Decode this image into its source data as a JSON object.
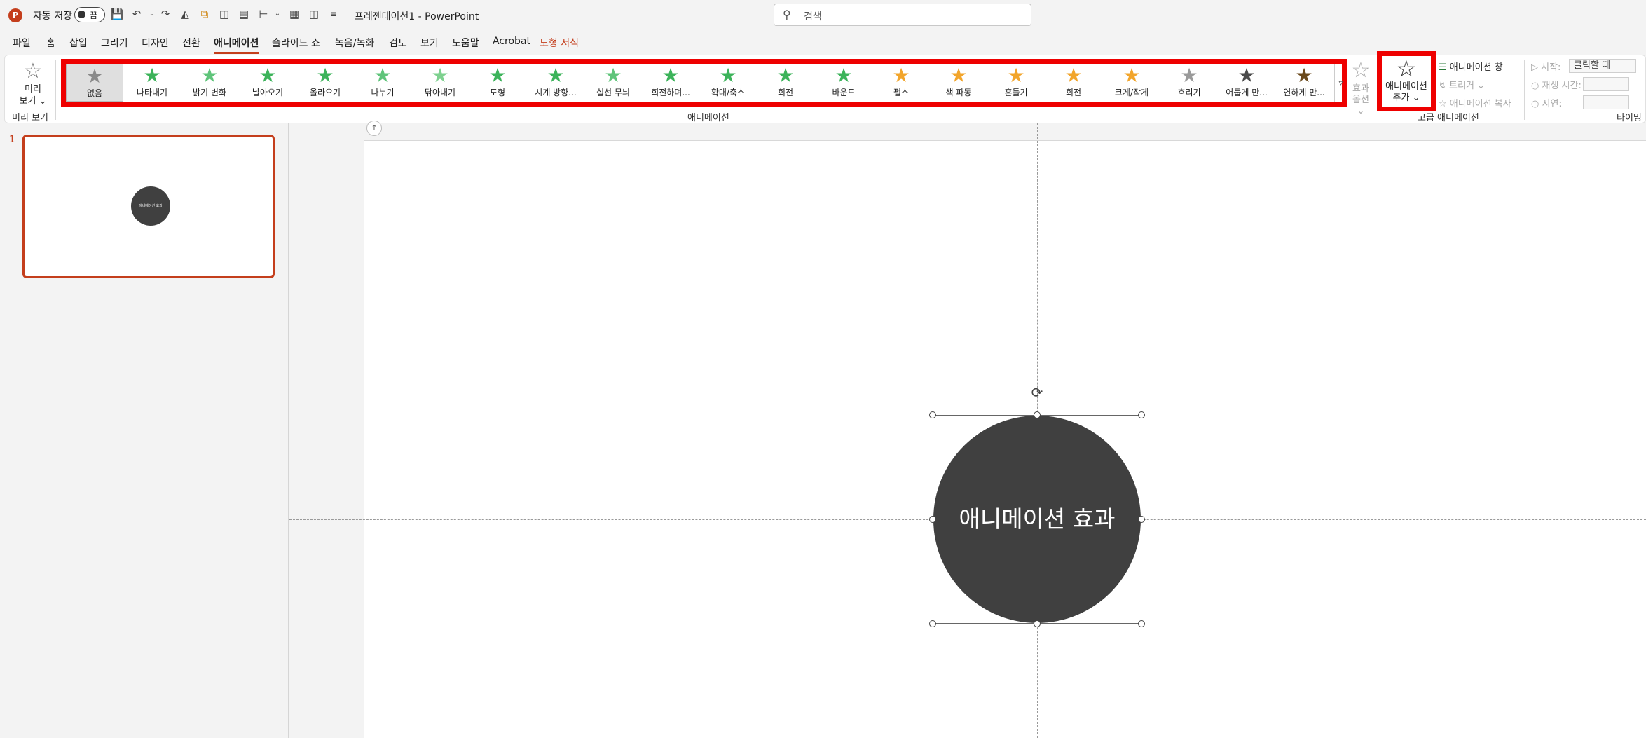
{
  "titlebar": {
    "app_logo": "P",
    "autosave_label": "자동 저장",
    "autosave_state": "끔",
    "doc_title": "프레젠테이션1  -  PowerPoint",
    "search_placeholder": "검색",
    "quick_access_icons": [
      "save-icon",
      "undo-icon",
      "redo-icon",
      "format-painter-icon",
      "copy-icon",
      "align-icon",
      "distribute-icon",
      "more-icon"
    ]
  },
  "menu": {
    "tabs": [
      {
        "label": "파일"
      },
      {
        "label": "홈"
      },
      {
        "label": "삽입"
      },
      {
        "label": "그리기"
      },
      {
        "label": "디자인"
      },
      {
        "label": "전환"
      },
      {
        "label": "애니메이션",
        "active": true
      },
      {
        "label": "슬라이드 쇼"
      },
      {
        "label": "녹음/녹화"
      },
      {
        "label": "검토"
      },
      {
        "label": "보기"
      },
      {
        "label": "도움말"
      },
      {
        "label": "Acrobat"
      },
      {
        "label": "도형 서식",
        "context": true
      }
    ]
  },
  "ribbon": {
    "preview": {
      "label_line1": "미리",
      "label_line2": "보기 ⌄",
      "group": "미리 보기"
    },
    "animation_group": "애니메이션",
    "effects": [
      {
        "label": "없음",
        "color": "#8a8a8a",
        "selected": true
      },
      {
        "label": "나타내기",
        "color": "#3cb35a"
      },
      {
        "label": "밝기 변화",
        "color": "#5fc47a"
      },
      {
        "label": "날아오기",
        "color": "#3cb35a"
      },
      {
        "label": "올라오기",
        "color": "#3cb35a"
      },
      {
        "label": "나누기",
        "color": "#5fc47a"
      },
      {
        "label": "닦아내기",
        "color": "#7ed18f"
      },
      {
        "label": "도형",
        "color": "#3cb35a"
      },
      {
        "label": "시계 방향...",
        "color": "#3cb35a"
      },
      {
        "label": "실선 무늬",
        "color": "#5fc47a"
      },
      {
        "label": "회전하며...",
        "color": "#3cb35a"
      },
      {
        "label": "확대/축소",
        "color": "#3cb35a"
      },
      {
        "label": "회전",
        "color": "#3cb35a"
      },
      {
        "label": "바운드",
        "color": "#3cb35a"
      },
      {
        "label": "펄스",
        "color": "#f2a52b"
      },
      {
        "label": "색 파동",
        "color": "#f2a52b"
      },
      {
        "label": "흔들기",
        "color": "#f2a52b"
      },
      {
        "label": "회전",
        "color": "#f2a52b"
      },
      {
        "label": "크게/작게",
        "color": "#f2a52b"
      },
      {
        "label": "흐리기",
        "color": "#9a9a9a"
      },
      {
        "label": "어둡게 만...",
        "color": "#4a4a4a"
      },
      {
        "label": "연하게 만...",
        "color": "#6b4a1c"
      }
    ],
    "effect_options": {
      "line1": "효과",
      "line2": "옵션 ⌄"
    },
    "add_animation": {
      "line1": "애니메이션",
      "line2": "추가 ⌄"
    },
    "advanced": {
      "pane": "애니메이션 창",
      "trigger": "트리거 ⌄",
      "painter": "애니메이션 복사",
      "group": "고급 애니메이션"
    },
    "timing": {
      "start_label": "시작:",
      "start_value": "클릭할 때",
      "duration_label": "재생 시간:",
      "delay_label": "지연:",
      "group": "타이밍"
    }
  },
  "slides": {
    "number": "1",
    "thumb_text": "애니메이션 효과"
  },
  "canvas": {
    "shape_text": "애니메이션 효과",
    "shape_color": "#404040",
    "accent": "#c43e1c",
    "highlight": "#ee0000"
  }
}
